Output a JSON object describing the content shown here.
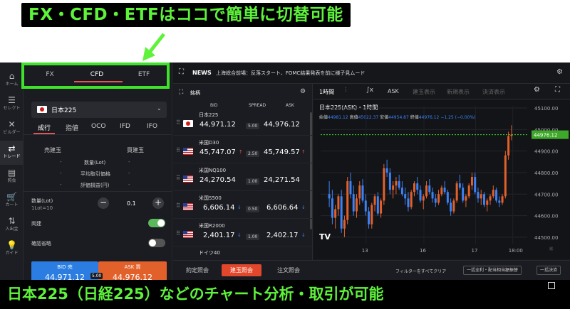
{
  "top_caption": "FX・CFD・ETFはココで簡単に切替可能",
  "bottom_caption": "日本225（日経225）などのチャート分析・取引が可能",
  "accent_green": "#5ef23b",
  "rail": [
    {
      "icon": "home-icon",
      "label": "ホーム"
    },
    {
      "icon": "select-icon",
      "label": "セレクト"
    },
    {
      "icon": "builder-icon",
      "label": "ビルダー"
    },
    {
      "icon": "trade-icon",
      "label": "トレード"
    },
    {
      "icon": "list-icon",
      "label": "照会"
    },
    {
      "icon": "cart-icon",
      "label": "カート"
    },
    {
      "icon": "transfer-icon",
      "label": "入出金"
    },
    {
      "icon": "guide-icon",
      "label": "ガイド"
    }
  ],
  "product_tabs": [
    "FX",
    "CFD",
    "ETF"
  ],
  "symbol_select": {
    "value": "日本225"
  },
  "order_tabs": [
    "成行",
    "指値",
    "OCO",
    "IFD",
    "IFO"
  ],
  "positions": {
    "sell_label": "売建玉",
    "buy_label": "買建玉",
    "rows": [
      "数量(Lot)",
      "平均取引価格",
      "評価損益(円)"
    ],
    "dash": "-"
  },
  "quantity": {
    "label": "数量(Lot)",
    "sub": "1Lot=10",
    "value": "0.1",
    "minus": "−",
    "plus": "+"
  },
  "both_label": "両建",
  "confirm_label": "確認省略",
  "bid_button": {
    "label": "BID 売",
    "price": "44,971.12"
  },
  "ask_button": {
    "label": "ASK 買",
    "price": "44,976.12"
  },
  "spread_badge": "5.00",
  "news": {
    "label": "NEWS",
    "text": "上海総合前場：反落スタート、FOMC結果発表を前に様子見ムード"
  },
  "list": {
    "title": "銘柄",
    "cols": [
      "BID",
      "SPREAD",
      "ASK"
    ],
    "rows": [
      {
        "name": "日本225",
        "flag": "jp",
        "bid": "44,971.12",
        "spread": "5.00",
        "ask": "44,976.12"
      },
      {
        "name": "米国D30",
        "flag": "us",
        "bid": "45,747.07",
        "spread": "2.50",
        "ask": "45,749.57"
      },
      {
        "name": "米国NQ100",
        "flag": "us",
        "bid": "24,270.54",
        "spread": "1.00",
        "ask": "24,271.54"
      },
      {
        "name": "米国S500",
        "flag": "us",
        "bid": "6,606.14",
        "spread": "0.50",
        "ask": "6,606.64"
      },
      {
        "name": "米国R2000",
        "flag": "us",
        "bid": "2,401.17",
        "spread": "1.00",
        "ask": "2,402.17"
      },
      {
        "name": "ドイツ40",
        "flag": "de",
        "bid": "",
        "spread": "",
        "ask": ""
      }
    ]
  },
  "chart_toolbar": {
    "interval": "1時間",
    "price_type": "ASK",
    "btn1": "建玉表示",
    "btn2": "新規表示",
    "btn3": "決済表示"
  },
  "chart_data": {
    "type": "candlestick",
    "title": "日本225(ASK)・1時間",
    "ohlc_label": {
      "open_k": "始値",
      "open": "44981.12",
      "high_k": "高値",
      "high": "45022.37",
      "low_k": "安値",
      "low": "44954.87",
      "close_k": "終値",
      "close": "44976.12",
      "change": "−1.25 (−0.00%)"
    },
    "y_ticks": [
      "45100.00",
      "45000.00",
      "44900.00",
      "44800.00",
      "44700.00",
      "44600.00",
      "44500.00"
    ],
    "ylim": [
      44470,
      45110
    ],
    "x_ticks": [
      "13",
      "16",
      "17",
      "18:00"
    ],
    "last_price": "44976.12",
    "up_color": "#e2612b",
    "down_color": "#3b82f6",
    "candles": [
      [
        44700,
        44760,
        44640,
        44680
      ],
      [
        44680,
        44720,
        44560,
        44590
      ],
      [
        44590,
        44650,
        44540,
        44630
      ],
      [
        44630,
        44700,
        44600,
        44690
      ],
      [
        44690,
        44720,
        44520,
        44540
      ],
      [
        44540,
        44600,
        44500,
        44580
      ],
      [
        44580,
        44780,
        44560,
        44760
      ],
      [
        44760,
        44800,
        44680,
        44700
      ],
      [
        44700,
        44740,
        44600,
        44620
      ],
      [
        44620,
        44700,
        44590,
        44680
      ],
      [
        44680,
        44760,
        44650,
        44740
      ],
      [
        44740,
        44770,
        44660,
        44670
      ],
      [
        44670,
        44700,
        44600,
        44620
      ],
      [
        44620,
        44640,
        44540,
        44560
      ],
      [
        44560,
        44660,
        44540,
        44650
      ],
      [
        44650,
        44700,
        44620,
        44690
      ],
      [
        44690,
        44710,
        44600,
        44610
      ],
      [
        44610,
        44680,
        44590,
        44670
      ],
      [
        44670,
        44840,
        44650,
        44820
      ],
      [
        44820,
        44860,
        44780,
        44800
      ],
      [
        44800,
        44820,
        44700,
        44720
      ],
      [
        44720,
        44760,
        44680,
        44740
      ],
      [
        44740,
        44780,
        44700,
        44760
      ],
      [
        44760,
        44790,
        44720,
        44730
      ],
      [
        44730,
        44760,
        44690,
        44700
      ],
      [
        44700,
        44730,
        44650,
        44680
      ],
      [
        44680,
        44710,
        44620,
        44640
      ],
      [
        44640,
        44720,
        44630,
        44710
      ],
      [
        44710,
        44760,
        44690,
        44750
      ],
      [
        44750,
        44780,
        44700,
        44720
      ],
      [
        44720,
        44740,
        44660,
        44670
      ],
      [
        44670,
        44700,
        44630,
        44690
      ],
      [
        44690,
        44760,
        44680,
        44740
      ],
      [
        44740,
        44770,
        44700,
        44710
      ],
      [
        44710,
        44730,
        44660,
        44680
      ],
      [
        44680,
        44700,
        44640,
        44660
      ],
      [
        44660,
        44720,
        44650,
        44700
      ],
      [
        44700,
        44740,
        44690,
        44730
      ],
      [
        44730,
        44760,
        44700,
        44710
      ],
      [
        44710,
        44720,
        44650,
        44660
      ],
      [
        44660,
        44680,
        44600,
        44620
      ],
      [
        44620,
        44680,
        44610,
        44670
      ],
      [
        44670,
        44760,
        44660,
        44750
      ],
      [
        44750,
        44790,
        44720,
        44730
      ],
      [
        44730,
        44750,
        44660,
        44670
      ],
      [
        44670,
        44700,
        44640,
        44690
      ],
      [
        44690,
        44750,
        44680,
        44740
      ],
      [
        44740,
        44800,
        44720,
        44780
      ],
      [
        44780,
        44800,
        44700,
        44710
      ],
      [
        44710,
        44730,
        44660,
        44680
      ],
      [
        44680,
        44720,
        44650,
        44700
      ],
      [
        44700,
        44710,
        44640,
        44650
      ],
      [
        44650,
        44680,
        44620,
        44670
      ],
      [
        44670,
        44700,
        44650,
        44690
      ],
      [
        44690,
        44740,
        44680,
        44720
      ],
      [
        44720,
        44730,
        44660,
        44670
      ],
      [
        44670,
        44690,
        44640,
        44660
      ],
      [
        44660,
        44700,
        44650,
        44690
      ],
      [
        44690,
        44900,
        44680,
        44880
      ],
      [
        44880,
        44990,
        44860,
        44970
      ],
      [
        44970,
        45020,
        44950,
        44976
      ]
    ]
  },
  "bottom_tabs": [
    "約定照会",
    "建玉照会",
    "注文照会"
  ],
  "bottom_buttons": [
    "フィルターをすべてクリア",
    "一括全利・配当相当額振替",
    "一括決済"
  ]
}
